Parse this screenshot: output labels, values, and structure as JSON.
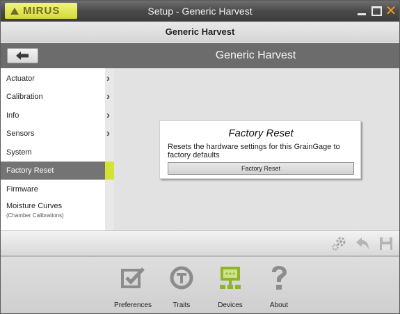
{
  "window": {
    "app_logo": "MIRUS",
    "title": "Setup - Generic Harvest"
  },
  "header": {
    "title": "Generic Harvest"
  },
  "navbar": {
    "title": "Generic Harvest"
  },
  "sidebar": {
    "items": [
      {
        "label": "Actuator",
        "has_arrow": true
      },
      {
        "label": "Calibration",
        "has_arrow": true
      },
      {
        "label": "Info",
        "has_arrow": true
      },
      {
        "label": "Sensors",
        "has_arrow": true
      },
      {
        "label": "System",
        "has_arrow": false
      },
      {
        "label": "Factory Reset",
        "has_arrow": false,
        "active": true
      },
      {
        "label": "Firmware",
        "has_arrow": false
      },
      {
        "label": "Moisture Curves",
        "sublabel": "(Chamber Calibrations)",
        "has_arrow": false
      }
    ]
  },
  "card": {
    "title": "Factory Reset",
    "description": "Resets the hardware settings for this GrainGage to factory defaults",
    "button_label": "Factory Reset"
  },
  "toolbar": {
    "icons": [
      "gears-icon",
      "undo-icon",
      "save-icon"
    ]
  },
  "bottom_nav": {
    "items": [
      {
        "label": "Preferences",
        "icon": "checkbox-icon",
        "color": "#8c8c8c"
      },
      {
        "label": "Traits",
        "icon": "traits-icon",
        "color": "#8c8c8c"
      },
      {
        "label": "Devices",
        "icon": "device-icon",
        "color": "#8fb32e"
      },
      {
        "label": "About",
        "icon": "question-icon",
        "color": "#8c8c8c"
      }
    ]
  },
  "colors": {
    "accent": "#d4e235",
    "close": "#f29a1b"
  }
}
